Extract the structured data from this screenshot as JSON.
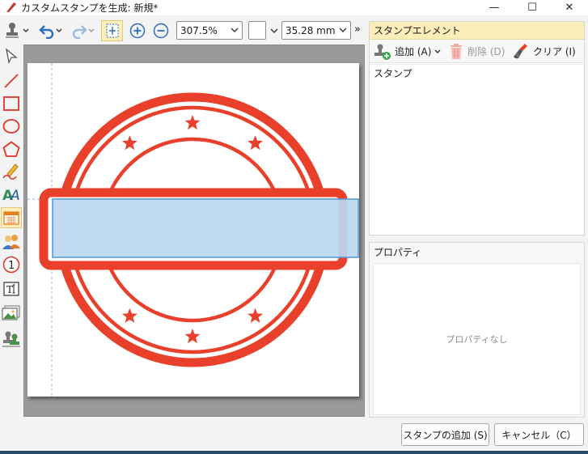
{
  "window": {
    "title": "カスタムスタンプを生成: 新規*",
    "minimize_glyph": "—",
    "maximize_glyph": "☐",
    "close_glyph": "✕"
  },
  "toolbar": {
    "zoom_value": "307.5%",
    "color_value": "",
    "width_value": "35.28 mm",
    "more_glyph": "»"
  },
  "stamp_elements": {
    "header": "スタンプエレメント",
    "add_label": "追加 (A)",
    "delete_label": "削除 (D)",
    "clear_label": "クリア (I)",
    "tree_root": "スタンプ"
  },
  "properties": {
    "header": "プロパティ",
    "empty_text": "プロパティなし"
  },
  "buttons": {
    "add_stamp": "スタンプの追加 (S)",
    "cancel": "キャンセル（C）"
  },
  "colors": {
    "stamp_red": "#e8402a",
    "selection_fill": "#bcd9f1",
    "selection_border": "#5b9bd5",
    "panel_header": "#fbeeb8",
    "accent_blue": "#2a6ebd"
  },
  "icons": [
    "app-icon",
    "stamp-tool-icon",
    "undo-icon",
    "redo-icon",
    "fit-page-icon",
    "zoom-in-icon",
    "zoom-out-icon",
    "select-arrow-icon",
    "line-icon",
    "rectangle-icon",
    "ellipse-icon",
    "polygon-icon",
    "pencil-icon",
    "text-style-icon",
    "date-icon",
    "user-icon",
    "number-icon",
    "text-box-icon",
    "image-icon",
    "stamp-icon",
    "add-icon",
    "trash-icon",
    "broom-icon"
  ]
}
